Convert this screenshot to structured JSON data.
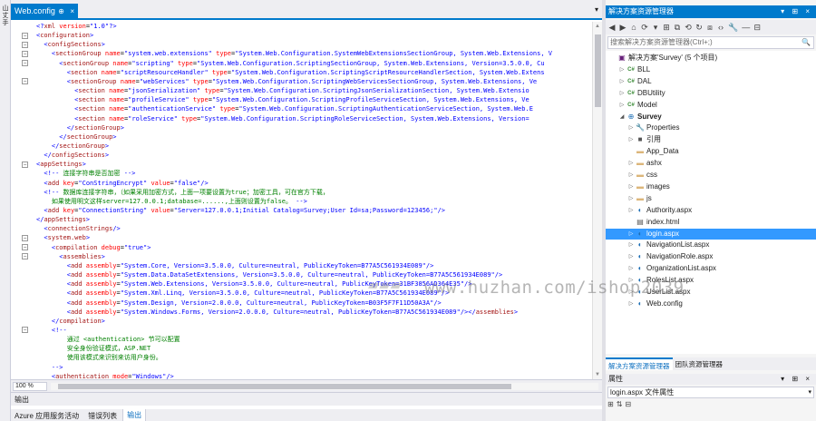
{
  "left_strip": {
    "text": "山\n丈\n手"
  },
  "editor": {
    "tab_label": "Web.config",
    "tab_pin": "⊕",
    "tab_close": "×",
    "tab_dropdown": "▾",
    "zoom": "100 %",
    "lines": [
      [
        [
          "p",
          "<?"
        ],
        [
          "t",
          "xml"
        ],
        [
          "a",
          " version"
        ],
        [
          "plain",
          "="
        ],
        [
          "v",
          "\"1.0\""
        ],
        [
          "p",
          "?>"
        ]
      ],
      [
        [
          "p",
          "<"
        ],
        [
          "t",
          "configuration"
        ],
        [
          "p",
          ">"
        ]
      ],
      [
        [
          "p",
          "  <"
        ],
        [
          "t",
          "configSections"
        ],
        [
          "p",
          ">"
        ]
      ],
      [
        [
          "p",
          "    <"
        ],
        [
          "t",
          "sectionGroup"
        ],
        [
          "a",
          " name"
        ],
        [
          "plain",
          "="
        ],
        [
          "v",
          "\"system.web.extensions\""
        ],
        [
          "a",
          " type"
        ],
        [
          "plain",
          "="
        ],
        [
          "v",
          "\"System.Web.Configuration.SystemWebExtensionsSectionGroup, System.Web.Extensions, V"
        ]
      ],
      [
        [
          "p",
          "      <"
        ],
        [
          "t",
          "sectionGroup"
        ],
        [
          "a",
          " name"
        ],
        [
          "plain",
          "="
        ],
        [
          "v",
          "\"scripting\""
        ],
        [
          "a",
          " type"
        ],
        [
          "plain",
          "="
        ],
        [
          "v",
          "\"System.Web.Configuration.ScriptingSectionGroup, System.Web.Extensions, Version=3.5.0.0, Cu"
        ]
      ],
      [
        [
          "p",
          "        <"
        ],
        [
          "t",
          "section"
        ],
        [
          "a",
          " name"
        ],
        [
          "plain",
          "="
        ],
        [
          "v",
          "\"scriptResourceHandler\""
        ],
        [
          "a",
          " type"
        ],
        [
          "plain",
          "="
        ],
        [
          "v",
          "\"System.Web.Configuration.ScriptingScriptResourceHandlerSection, System.Web.Extens"
        ]
      ],
      [
        [
          "p",
          "        <"
        ],
        [
          "t",
          "sectionGroup"
        ],
        [
          "a",
          " name"
        ],
        [
          "plain",
          "="
        ],
        [
          "v",
          "\"webServices\""
        ],
        [
          "a",
          " type"
        ],
        [
          "plain",
          "="
        ],
        [
          "v",
          "\"System.Web.Configuration.ScriptingWebServicesSectionGroup, System.Web.Extensions, Ve"
        ]
      ],
      [
        [
          "p",
          "          <"
        ],
        [
          "t",
          "section"
        ],
        [
          "a",
          " name"
        ],
        [
          "plain",
          "="
        ],
        [
          "v",
          "\"jsonSerialization\""
        ],
        [
          "a",
          " type"
        ],
        [
          "plain",
          "="
        ],
        [
          "v",
          "\"System.Web.Configuration.ScriptingJsonSerializationSection, System.Web.Extensio"
        ]
      ],
      [
        [
          "p",
          "          <"
        ],
        [
          "t",
          "section"
        ],
        [
          "a",
          " name"
        ],
        [
          "plain",
          "="
        ],
        [
          "v",
          "\"profileService\""
        ],
        [
          "a",
          " type"
        ],
        [
          "plain",
          "="
        ],
        [
          "v",
          "\"System.Web.Configuration.ScriptingProfileServiceSection, System.Web.Extensions, Ve"
        ]
      ],
      [
        [
          "p",
          "          <"
        ],
        [
          "t",
          "section"
        ],
        [
          "a",
          " name"
        ],
        [
          "plain",
          "="
        ],
        [
          "v",
          "\"authenticationService\""
        ],
        [
          "a",
          " type"
        ],
        [
          "plain",
          "="
        ],
        [
          "v",
          "\"System.Web.Configuration.ScriptingAuthenticationServiceSection, System.Web.E"
        ]
      ],
      [
        [
          "p",
          "          <"
        ],
        [
          "t",
          "section"
        ],
        [
          "a",
          " name"
        ],
        [
          "plain",
          "="
        ],
        [
          "v",
          "\"roleService\""
        ],
        [
          "a",
          " type"
        ],
        [
          "plain",
          "="
        ],
        [
          "v",
          "\"System.Web.Configuration.ScriptingRoleServiceSection, System.Web.Extensions, Version="
        ]
      ],
      [
        [
          "p",
          "        </"
        ],
        [
          "t",
          "sectionGroup"
        ],
        [
          "p",
          ">"
        ]
      ],
      [
        [
          "p",
          "      </"
        ],
        [
          "t",
          "sectionGroup"
        ],
        [
          "p",
          ">"
        ]
      ],
      [
        [
          "p",
          "    </"
        ],
        [
          "t",
          "sectionGroup"
        ],
        [
          "p",
          ">"
        ]
      ],
      [
        [
          "p",
          "  </"
        ],
        [
          "t",
          "configSections"
        ],
        [
          "p",
          ">"
        ]
      ],
      [
        [
          "p",
          "<"
        ],
        [
          "t",
          "appSettings"
        ],
        [
          "p",
          ">"
        ]
      ],
      [
        [
          "p",
          "  <!--"
        ],
        [
          "c",
          " 连接字符串是否加密 "
        ],
        [
          "p",
          "-->"
        ]
      ],
      [
        [
          "p",
          "  <"
        ],
        [
          "t",
          "add"
        ],
        [
          "a",
          " key"
        ],
        [
          "plain",
          "="
        ],
        [
          "v",
          "\"ConStringEncrypt\""
        ],
        [
          "a",
          " value"
        ],
        [
          "plain",
          "="
        ],
        [
          "v",
          "\"false\""
        ],
        [
          "p",
          "/>"
        ]
      ],
      [
        [
          "p",
          "  <!--"
        ],
        [
          "c",
          " 数据库连接字符串，（如果采用加密方式，上面一项要设置为true；加密工具，可在官方下载，"
        ]
      ],
      [
        [
          "c",
          "    如果使用明文这样server=127.0.0.1;database=......,上面则设置为false。 "
        ],
        [
          "p",
          "-->"
        ]
      ],
      [
        [
          "p",
          "  <"
        ],
        [
          "t",
          "add"
        ],
        [
          "a",
          " key"
        ],
        [
          "plain",
          "="
        ],
        [
          "v",
          "\"ConnectionString\""
        ],
        [
          "a",
          " value"
        ],
        [
          "plain",
          "="
        ],
        [
          "v",
          "\"Server=127.0.0.1;Initial Catalog=Survey;User Id=sa;Password=123456;\""
        ],
        [
          "p",
          "/>"
        ]
      ],
      [
        [
          "p",
          "</"
        ],
        [
          "t",
          "appSettings"
        ],
        [
          "p",
          ">"
        ]
      ],
      [
        [
          "p",
          "  <"
        ],
        [
          "t",
          "connectionStrings"
        ],
        [
          "p",
          "/>"
        ]
      ],
      [
        [
          "p",
          "  <"
        ],
        [
          "t",
          "system.web"
        ],
        [
          "p",
          ">"
        ]
      ],
      [
        [
          "p",
          "    <"
        ],
        [
          "t",
          "compilation"
        ],
        [
          "a",
          " debug"
        ],
        [
          "plain",
          "="
        ],
        [
          "v",
          "\"true\""
        ],
        [
          "p",
          ">"
        ]
      ],
      [
        [
          "p",
          "      <"
        ],
        [
          "t",
          "assemblies"
        ],
        [
          "p",
          ">"
        ]
      ],
      [
        [
          "p",
          "        <"
        ],
        [
          "t",
          "add"
        ],
        [
          "a",
          " assembly"
        ],
        [
          "plain",
          "="
        ],
        [
          "v",
          "\"System.Core, Version=3.5.0.0, Culture=neutral, PublicKeyToken=B77A5C561934E089\""
        ],
        [
          "p",
          "/>"
        ]
      ],
      [
        [
          "p",
          "        <"
        ],
        [
          "t",
          "add"
        ],
        [
          "a",
          " assembly"
        ],
        [
          "plain",
          "="
        ],
        [
          "v",
          "\"System.Data.DataSetExtensions, Version=3.5.0.0, Culture=neutral, PublicKeyToken=B77A5C561934E089\""
        ],
        [
          "p",
          "/>"
        ]
      ],
      [
        [
          "p",
          "        <"
        ],
        [
          "t",
          "add"
        ],
        [
          "a",
          " assembly"
        ],
        [
          "plain",
          "="
        ],
        [
          "v",
          "\"System.Web.Extensions, Version=3.5.0.0, Culture=neutral, PublicKeyToken=31BF3856AD364E35\""
        ],
        [
          "p",
          "/>"
        ]
      ],
      [
        [
          "p",
          "        <"
        ],
        [
          "t",
          "add"
        ],
        [
          "a",
          " assembly"
        ],
        [
          "plain",
          "="
        ],
        [
          "v",
          "\"System.Xml.Linq, Version=3.5.0.0, Culture=neutral, PublicKeyToken=B77A5C561934E089\""
        ],
        [
          "p",
          "/>"
        ]
      ],
      [
        [
          "p",
          "        <"
        ],
        [
          "t",
          "add"
        ],
        [
          "a",
          " assembly"
        ],
        [
          "plain",
          "="
        ],
        [
          "v",
          "\"System.Design, Version=2.0.0.0, Culture=neutral, PublicKeyToken=B03F5F7F11D50A3A\""
        ],
        [
          "p",
          "/>"
        ]
      ],
      [
        [
          "p",
          "        <"
        ],
        [
          "t",
          "add"
        ],
        [
          "a",
          " assembly"
        ],
        [
          "plain",
          "="
        ],
        [
          "v",
          "\"System.Windows.Forms, Version=2.0.0.0, Culture=neutral, PublicKeyToken=B77A5C561934E089\""
        ],
        [
          "p",
          "/></"
        ],
        [
          "t",
          "assemblies"
        ],
        [
          "p",
          ">"
        ]
      ],
      [
        [
          "p",
          "    </"
        ],
        [
          "t",
          "compilation"
        ],
        [
          "p",
          ">"
        ]
      ],
      [
        [
          "p",
          "    <!--"
        ]
      ],
      [
        [
          "c",
          "        通过 <authentication> 节可以配置"
        ]
      ],
      [
        [
          "c",
          "        安全身份验证模式，ASP.NET"
        ]
      ],
      [
        [
          "c",
          "        使用该模式来识别来访用户身份。"
        ]
      ],
      [
        [
          "p",
          "    -->"
        ]
      ],
      [
        [
          "p",
          "    <"
        ],
        [
          "t",
          "authentication"
        ],
        [
          "a",
          " mode"
        ],
        [
          "plain",
          "="
        ],
        [
          "v",
          "\"Windows\""
        ],
        [
          "p",
          "/>"
        ]
      ]
    ]
  },
  "output": {
    "header": "输出",
    "tabs": [
      "Azure 应用服务活动",
      "错误列表",
      "输出"
    ]
  },
  "solution_explorer": {
    "title": "解决方案资源管理器",
    "title_controls": "▾ ⊞ ×",
    "toolbar_icons": [
      "◀",
      "▶",
      "⌂",
      "⟳",
      "▾",
      "⊞",
      "⧉",
      "⟲",
      "↻",
      "⧈",
      "‹›",
      "🔧",
      "—",
      "⊟"
    ],
    "search_placeholder": "搜索解决方案资源管理器(Ctrl+;)",
    "search_icon": "🔍",
    "items": [
      {
        "label": "解决方案'Survey' (5 个项目)",
        "icon": "sln",
        "glyph": "▣",
        "depth": 0,
        "arrow": ""
      },
      {
        "label": "BLL",
        "icon": "cs",
        "glyph": "C#",
        "depth": 1,
        "arrow": "▷"
      },
      {
        "label": "DAL",
        "icon": "cs",
        "glyph": "C#",
        "depth": 1,
        "arrow": "▷"
      },
      {
        "label": "DBUtility",
        "icon": "cs",
        "glyph": "C#",
        "depth": 1,
        "arrow": "▷"
      },
      {
        "label": "Model",
        "icon": "cs",
        "glyph": "C#",
        "depth": 1,
        "arrow": "▷"
      },
      {
        "label": "Survey",
        "icon": "web",
        "glyph": "⊕",
        "depth": 1,
        "arrow": "◢"
      },
      {
        "label": "Properties",
        "icon": "file",
        "glyph": "🔧",
        "depth": 2,
        "arrow": "▷"
      },
      {
        "label": "引用",
        "icon": "file",
        "glyph": "■",
        "depth": 2,
        "arrow": "▷"
      },
      {
        "label": "App_Data",
        "icon": "folder",
        "glyph": "▬",
        "depth": 2,
        "arrow": ""
      },
      {
        "label": "ashx",
        "icon": "folder",
        "glyph": "▬",
        "depth": 2,
        "arrow": "▷"
      },
      {
        "label": "css",
        "icon": "folder",
        "glyph": "▬",
        "depth": 2,
        "arrow": "▷"
      },
      {
        "label": "images",
        "icon": "folder",
        "glyph": "▬",
        "depth": 2,
        "arrow": "▷"
      },
      {
        "label": "js",
        "icon": "folder",
        "glyph": "▬",
        "depth": 2,
        "arrow": "▷"
      },
      {
        "label": "Authority.aspx",
        "icon": "web",
        "glyph": "◐",
        "depth": 2,
        "arrow": "▷"
      },
      {
        "label": "index.html",
        "icon": "file",
        "glyph": "▤",
        "depth": 2,
        "arrow": ""
      },
      {
        "label": "login.aspx",
        "icon": "web",
        "glyph": "◐",
        "depth": 2,
        "arrow": "▷",
        "selected": true
      },
      {
        "label": "NavigationList.aspx",
        "icon": "web",
        "glyph": "◐",
        "depth": 2,
        "arrow": "▷"
      },
      {
        "label": "NavigationRole.aspx",
        "icon": "web",
        "glyph": "◐",
        "depth": 2,
        "arrow": "▷"
      },
      {
        "label": "OrganizationList.aspx",
        "icon": "web",
        "glyph": "◐",
        "depth": 2,
        "arrow": "▷"
      },
      {
        "label": "RolesList.aspx",
        "icon": "web",
        "glyph": "◐",
        "depth": 2,
        "arrow": "▷"
      },
      {
        "label": "UserList.aspx",
        "icon": "web",
        "glyph": "◐",
        "depth": 2,
        "arrow": "▷"
      },
      {
        "label": "Web.config",
        "icon": "web",
        "glyph": "◐",
        "depth": 2,
        "arrow": "▷"
      }
    ],
    "bottom_tabs": [
      "解决方案资源管理器",
      "团队资源管理器"
    ]
  },
  "properties": {
    "title": "属性",
    "title_controls": "▾ ⊞ ×",
    "selected_object": "login.aspx 文件属性",
    "dropdown_icon": "▾",
    "toolbar_icons": [
      "⊞",
      "⇅",
      "⊟"
    ]
  },
  "watermark": {
    "text": "www.huzhan.com/ishop2039"
  }
}
